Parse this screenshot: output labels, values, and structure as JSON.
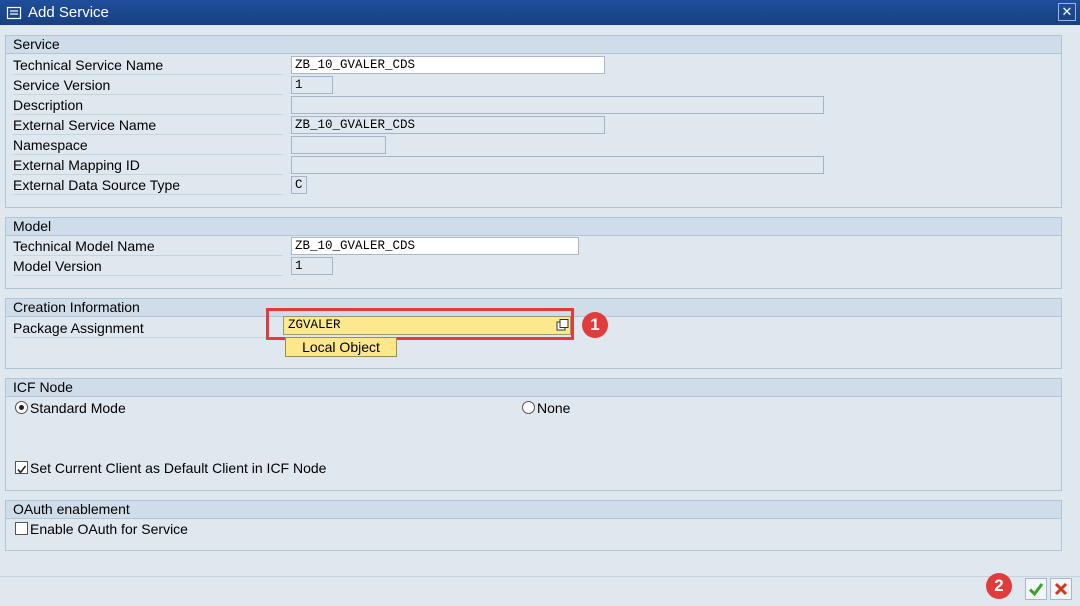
{
  "window": {
    "title": "Add Service",
    "close_icon": "close-icon"
  },
  "service": {
    "header": "Service",
    "technical_service_name": {
      "label": "Technical Service Name",
      "value": "ZB_10_GVALER_CDS"
    },
    "service_version": {
      "label": "Service Version",
      "value": "1"
    },
    "description": {
      "label": "Description",
      "value": ""
    },
    "external_service_name": {
      "label": "External Service Name",
      "value": "ZB_10_GVALER_CDS"
    },
    "namespace": {
      "label": "Namespace",
      "value": ""
    },
    "external_mapping_id": {
      "label": "External Mapping ID",
      "value": ""
    },
    "external_data_source_type": {
      "label": "External Data Source Type",
      "value": "C"
    }
  },
  "model": {
    "header": "Model",
    "technical_model_name": {
      "label": "Technical Model Name",
      "value": "ZB_10_GVALER_CDS"
    },
    "model_version": {
      "label": "Model Version",
      "value": "1"
    }
  },
  "creation": {
    "header": "Creation Information",
    "package_assignment": {
      "label": "Package Assignment",
      "value": "ZGVALER"
    },
    "local_object_button": "Local Object",
    "annotation_1": "1"
  },
  "icf": {
    "header": "ICF Node",
    "standard_mode": "Standard Mode",
    "none": "None",
    "set_default_client": "Set Current Client as Default Client in ICF Node",
    "standard_mode_selected": true,
    "set_default_client_checked": true
  },
  "oauth": {
    "header": "OAuth enablement",
    "enable_oauth": "Enable OAuth for Service",
    "enable_oauth_checked": false
  },
  "footer": {
    "annotation_2": "2",
    "ok_icon": "checkmark-icon",
    "cancel_icon": "cancel-icon"
  },
  "colors": {
    "title_bar": "#1f4f9c",
    "highlight": "#e23b3b",
    "package_field": "#fde98d",
    "ok": "#3aa02d",
    "cancel": "#d3361e"
  }
}
